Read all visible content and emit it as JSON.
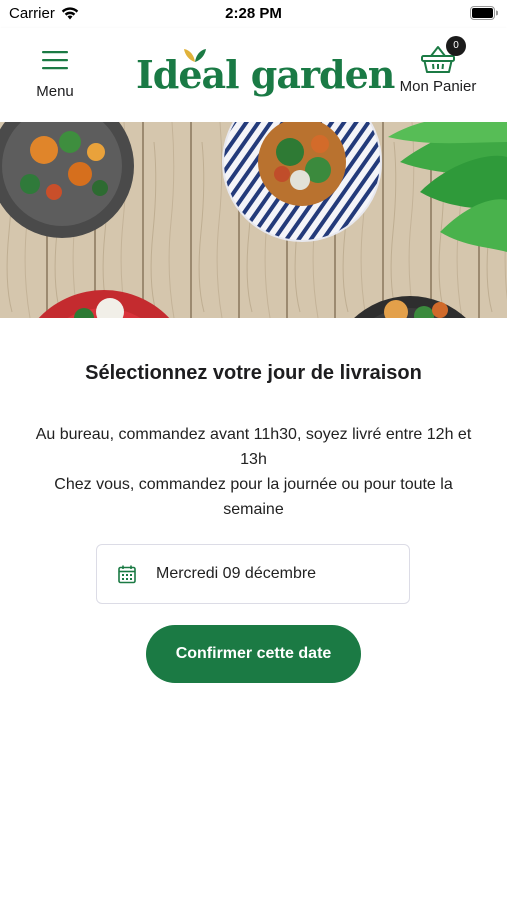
{
  "status_bar": {
    "carrier": "Carrier",
    "time": "2:28 PM",
    "icons": [
      "wifi-icon",
      "battery-icon"
    ]
  },
  "header": {
    "menu_label": "Menu",
    "logo_text": "Ideal garden",
    "cart_label": "Mon Panier",
    "cart_count": "0",
    "icons": [
      "hamburger-menu-icon",
      "shopping-basket-icon",
      "leaf-icon"
    ]
  },
  "hero": {
    "icons": [
      "salad-bowl-illustration"
    ]
  },
  "delivery": {
    "heading": "Sélectionnez votre jour de livraison",
    "office_text": "Au bureau, commandez avant 11h30, soyez livré entre 12h et 13h",
    "home_text": "Chez vous, commandez pour la journée ou pour toute la semaine",
    "selected_date": "Mercredi 09 décembre",
    "confirm_label": "Confirmer cette date",
    "icons": [
      "calendar-icon"
    ]
  },
  "colors": {
    "brand_green": "#1b7a44",
    "badge": "#1b1b1b",
    "field_border": "#dcdce6"
  }
}
